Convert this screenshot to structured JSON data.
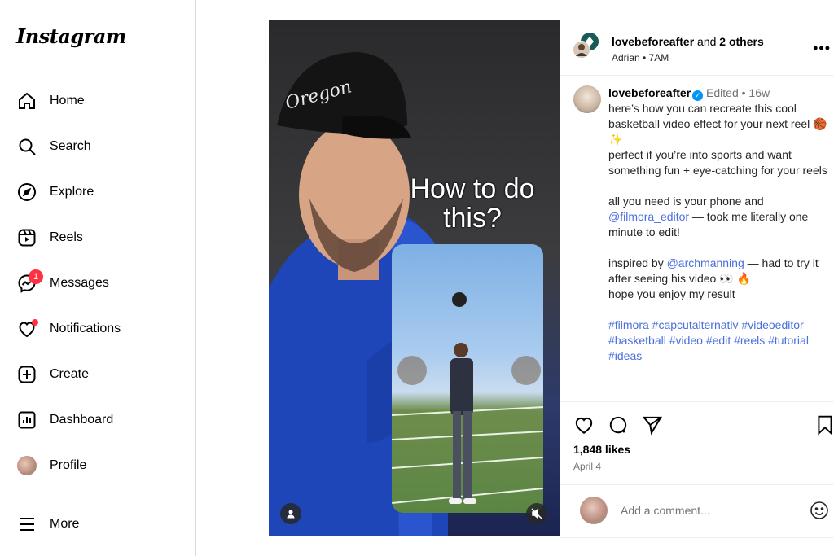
{
  "sidebar": {
    "logo": "Instagram",
    "items": [
      {
        "label": "Home",
        "icon": "home-icon"
      },
      {
        "label": "Search",
        "icon": "search-icon"
      },
      {
        "label": "Explore",
        "icon": "compass-icon"
      },
      {
        "label": "Reels",
        "icon": "reels-icon"
      },
      {
        "label": "Messages",
        "icon": "messenger-icon",
        "badge": "1"
      },
      {
        "label": "Notifications",
        "icon": "heart-icon"
      },
      {
        "label": "Create",
        "icon": "plus-square-icon"
      },
      {
        "label": "Dashboard",
        "icon": "dashboard-icon"
      },
      {
        "label": "Profile",
        "icon": "avatar"
      },
      {
        "label": "More",
        "icon": "hamburger-icon"
      }
    ]
  },
  "post": {
    "overlay_text": "How to do this?",
    "header": {
      "author": "lovebeforeafter",
      "and": "and",
      "others": "2 others",
      "sub": "Adrian • 7AM"
    },
    "caption": {
      "author": "lovebeforeafter",
      "meta": "Edited • 16w",
      "line1": "here’s how you can recreate this cool basketball video effect for your next reel 🏀✨",
      "line2": "perfect if you’re into sports and want something fun + eye-catching for your reels",
      "line3_pre": "all you need is your phone and",
      "mention1": "@filmora_editor",
      "line3_post": "— took me literally one minute to edit!",
      "line4_pre": "inspired by",
      "mention2": "@archmanning",
      "line4_post": "— had to try it after seeing his video 👀 🔥",
      "line5": "hope you enjoy my result",
      "hashtags": "#filmora #capcutalternativ #videoeditor #basketball #video #edit #reels #tutorial #ideas"
    },
    "likes": "1,848 likes",
    "date": "April 4",
    "comment_placeholder": "Add a comment..."
  },
  "colors": {
    "accent_blue": "#0095f6",
    "link_blue": "#4a6fdc",
    "badge_red": "#ff3040"
  }
}
